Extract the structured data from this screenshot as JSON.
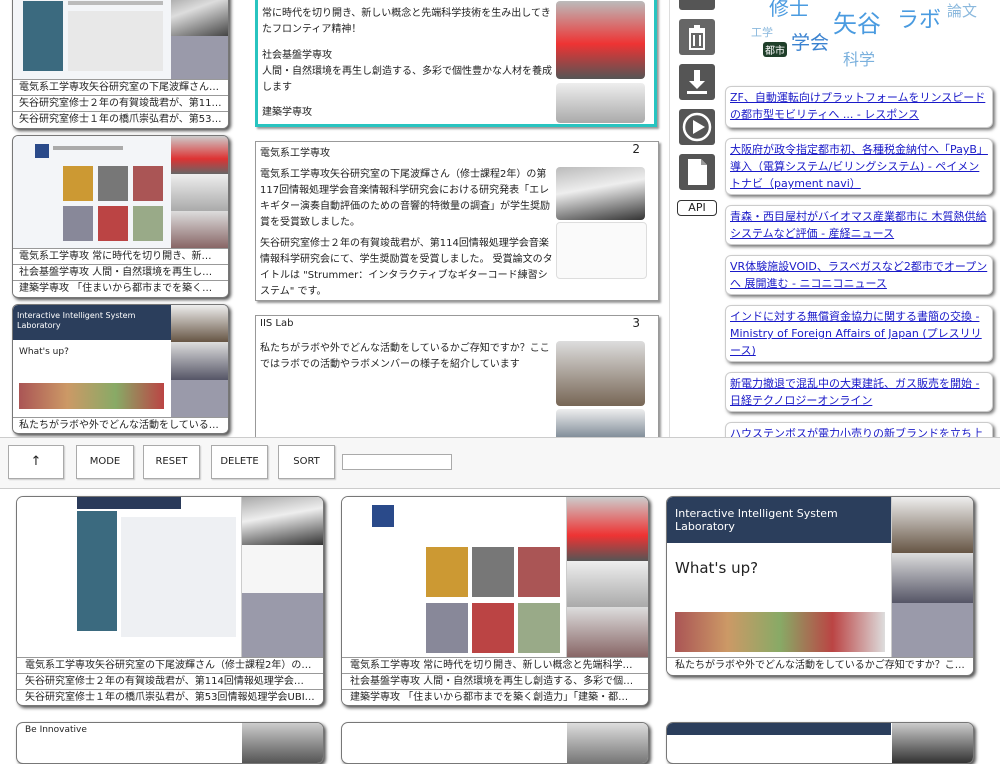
{
  "left_cards": [
    {
      "captions": [
        "電気系工学専攻矢谷研究室の下尾波輝さん…",
        "矢谷研究室修士２年の有賀竣哉君が、第11…",
        "矢谷研究室修士１年の橋爪崇弘君が、第53…"
      ]
    },
    {
      "captions": [
        "電気系工学専攻 常に時代を切り開き、新…",
        "社会基盤学専攻 人間・自然環境を再生し…",
        "建築学専攻 「住まいから都市までを築く…"
      ]
    },
    {
      "captions": [
        "私たちがラボや外でどんな活動をしている…"
      ]
    }
  ],
  "panel1": {
    "text": [
      "常に時代を切り開き、新しい概念と先端科学技術を生み出してきたフロンティア精神！",
      "社会基盤学専攻",
      "人間・自然環境を再生し創造する、多彩で個性豊かな人材を養成します",
      "建築学専攻"
    ]
  },
  "panel2": {
    "title": "電気系工学専攻",
    "num": "2",
    "para1": "電気系工学専攻矢谷研究室の下尾波輝さん（修士課程2年）の第117回情報処理学会音楽情報科学研究会における研究発表「エレキギター演奏自動評価のための音響的特徴量の調査」が学生奨励賞を受賞致しました。",
    "para2": "矢谷研究室修士２年の有賀竣哉君が、第114回情報処理学会音楽情報科学研究会にて、学生奨励賞を受賞しました。 受賞論文のタイトルは \"Strummer：インタラクティブなギターコード練習システム\" です。"
  },
  "panel3": {
    "title": "IIS Lab",
    "num": "3",
    "text": "私たちがラボや外でどんな活動をしているかご存知ですか？ここではラボでの活動やラボメンバーの様子を紹介しています"
  },
  "toolbar": {
    "up_label": "↑",
    "mode_label": "MODE",
    "reset_label": "RESET",
    "delete_label": "DELETE",
    "sort_label": "SORT",
    "input_value": ""
  },
  "icons": {
    "trash": "trash-icon",
    "download": "download-icon",
    "play": "play-icon",
    "document": "document-icon",
    "api_label": "API"
  },
  "word_cloud": {
    "words": [
      "修士",
      "矢谷",
      "ラボ",
      "論文",
      "工学",
      "学会",
      "都市",
      "科学"
    ]
  },
  "news": [
    "ZF、自動運転向けプラットフォームをリンスピードの都市型モビリティへ ... - レスポンス",
    "大阪府が政令指定都市初、各種税金納付へ「PayB」導入（電算システム/ビリングシステム) - ペイメントナビ（payment navi）",
    "青森・西目屋村がバイオマス産業都市に 木質熱供給システムなど評価 - 産経ニュース",
    "VR体験施設VOID、ラスベガスなど2都市でオープンへ 展開進む - ニコニコニュース",
    "インドに対する無償資金協力に関する書簡の交換 - Ministry of Foreign Affairs of Japan (プレスリリース)",
    "新電力撤退で混乱中の大東建託、ガス販売を開始 - 日経テクノロジーオンライン",
    "ハウステンボスが電力小売りの新ブランドを立ち上"
  ],
  "bottom_cards": [
    {
      "captions": [
        "電気系工学専攻矢谷研究室の下尾波輝さん（修士課程2年）の…",
        "矢谷研究室修士２年の有賀竣哉君が、第114回情報処理学会…",
        "矢谷研究室修士１年の橋爪崇弘君が、第53回情報処理学会UBI…"
      ]
    },
    {
      "captions": [
        "電気系工学専攻 常に時代を切り開き、新しい概念と先端科学…",
        "社会基盤学専攻 人間・自然環境を再生し創造する、多彩で個…",
        "建築学専攻 「住まいから都市までを築く創造力」「建築・都…"
      ]
    },
    {
      "captions": [
        "私たちがラボや外でどんな活動をしているかご存知ですか？こ…"
      ],
      "banner": "Interactive Intelligent System Laboratory",
      "whatsup": "What's up?"
    }
  ],
  "bottom_row2": {
    "card1_text": "Be Innovative"
  },
  "left_card3": {
    "banner": "Interactive Intelligent System Laboratory",
    "whatsup": "What's up?"
  }
}
